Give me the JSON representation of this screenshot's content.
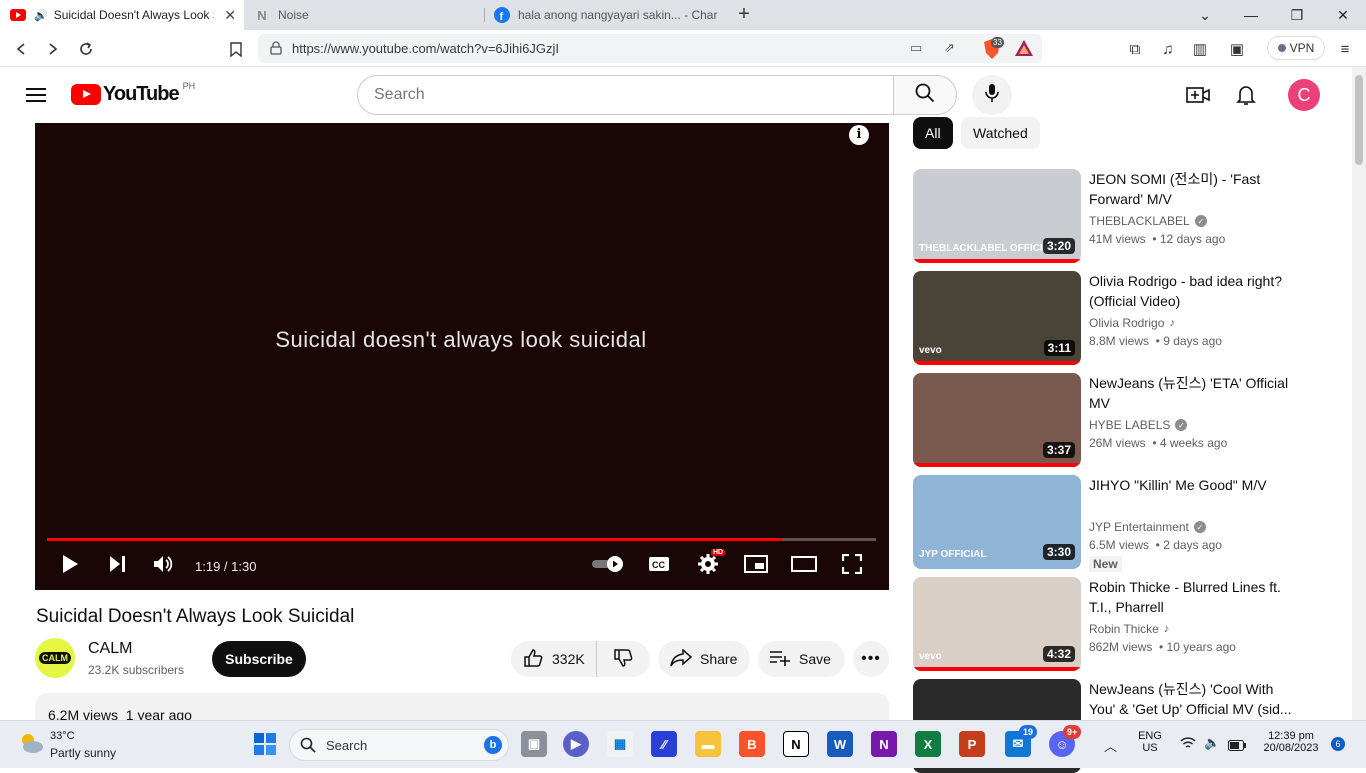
{
  "browser": {
    "tabs": [
      {
        "title": "Suicidal Doesn't Always Look S",
        "active": true
      },
      {
        "title": "Noise",
        "active": false
      },
      {
        "title": "hala anong nangyayari sakin... - Charle",
        "active": false
      }
    ],
    "url": "https://www.youtube.com/watch?v=6Jihi6JGzjI",
    "shield_count": "33",
    "vpn_label": "VPN"
  },
  "header": {
    "logo_text": "YouTube",
    "country_code": "PH",
    "search_placeholder": "Search",
    "avatar_letter": "C"
  },
  "player": {
    "caption": "Suicidal doesn't always look suicidal",
    "time": "1:19 / 1:30",
    "progress": 0.887,
    "hd_badge": "HD"
  },
  "video": {
    "title": "Suicidal Doesn't Always Look Suicidal",
    "channel": "CALM",
    "channel_avatar_text": "CALM",
    "subscribers": "23.2K subscribers",
    "subscribe_label": "Subscribe",
    "likes": "332K",
    "share_label": "Share",
    "save_label": "Save",
    "views_date": "6.2M views  1 year ago"
  },
  "sidebar": {
    "chips": [
      "All",
      "Watched"
    ],
    "recommendations": [
      {
        "title": "JEON SOMI (전소미) - 'Fast Forward' M/V",
        "channel": "THEBLACKLABEL",
        "verified": true,
        "meta": "41M views  • 12 days ago",
        "duration": "3:20",
        "watermark": "THEBLACKLABEL OFFICIAL",
        "thumb_color": "#c9cdd2",
        "progress": 1.0
      },
      {
        "title": "Olivia Rodrigo - bad idea right? (Official Video)",
        "channel": "Olivia Rodrigo",
        "music": true,
        "meta": "8.8M views  • 9 days ago",
        "duration": "3:11",
        "watermark": "vevo",
        "thumb_color": "#4a4337",
        "progress": 1.0
      },
      {
        "title": "NewJeans (뉴진스) 'ETA' Official MV",
        "channel": "HYBE LABELS",
        "verified": true,
        "meta": "26M views  • 4 weeks ago",
        "duration": "3:37",
        "watermark": "",
        "thumb_color": "#7a5a4e",
        "progress": 1.0
      },
      {
        "title": "JIHYO \"Killin' Me Good\" M/V",
        "channel": "JYP Entertainment",
        "verified": true,
        "meta": "6.5M views  • 2 days ago",
        "badge": "New",
        "duration": "3:30",
        "watermark": "JYP OFFICIAL",
        "thumb_color": "#8fb4d6",
        "progress": 0.0
      },
      {
        "title": "Robin Thicke - Blurred Lines ft. T.I., Pharrell",
        "channel": "Robin Thicke",
        "music": true,
        "meta": "862M views  • 10 years ago",
        "duration": "4:32",
        "watermark": "vevo",
        "thumb_color": "#d9cfc6",
        "progress": 1.0
      },
      {
        "title": "NewJeans (뉴진스) 'Cool With You' & 'Get Up' Official MV (sid...",
        "channel": "",
        "meta": "",
        "duration": "",
        "watermark": "",
        "thumb_color": "#2a2a2a",
        "progress": 0.0
      }
    ]
  },
  "taskbar": {
    "temperature": "33°C",
    "weather": "Partly sunny",
    "search_label": "Search",
    "lang": "ENG",
    "region": "US",
    "time": "12:39 pm",
    "date": "20/08/2023",
    "notifications": "6",
    "badge_outlook": "19",
    "badge_discord": "9+"
  },
  "colors": {
    "accent": "#ff0000",
    "brand_bg": "#0f0f0f"
  }
}
